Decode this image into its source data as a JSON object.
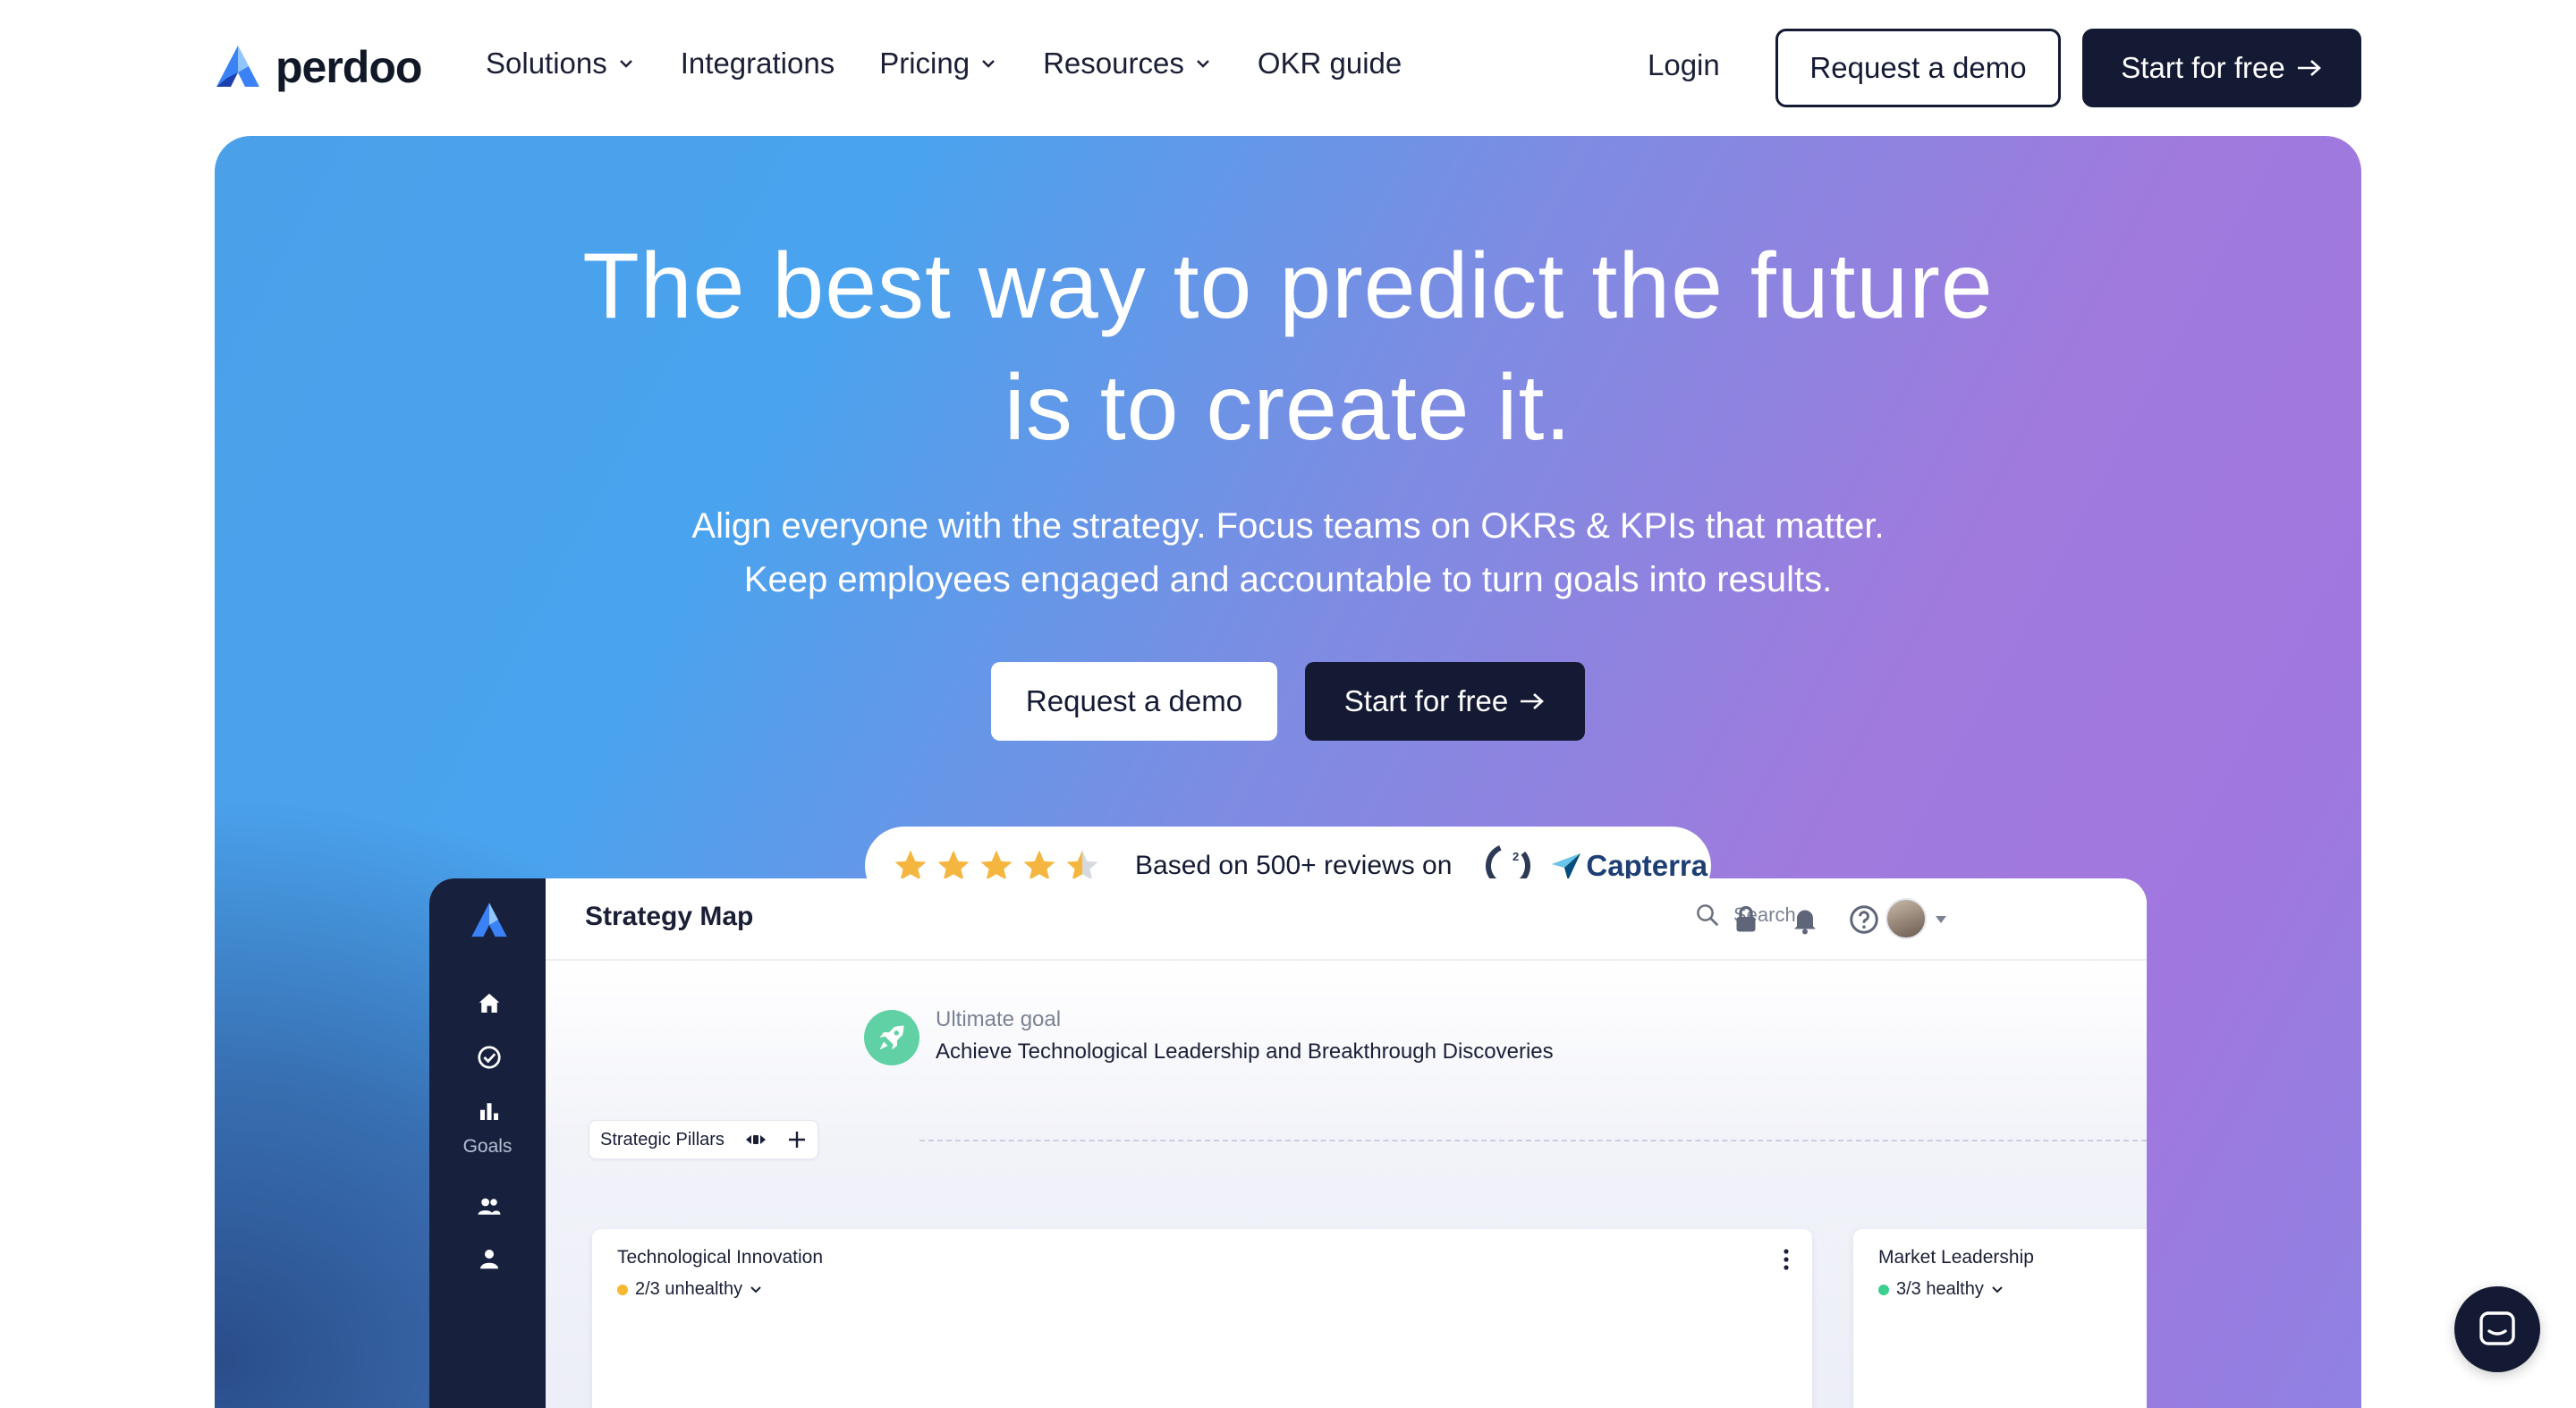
{
  "brand": {
    "name": "perdoo",
    "accent": "#3b82f6",
    "dark": "#141a33"
  },
  "nav": {
    "items": [
      {
        "label": "Solutions",
        "dropdown": true
      },
      {
        "label": "Integrations",
        "dropdown": false
      },
      {
        "label": "Pricing",
        "dropdown": true
      },
      {
        "label": "Resources",
        "dropdown": true
      },
      {
        "label": "OKR guide",
        "dropdown": false
      }
    ],
    "login": "Login",
    "demo": "Request a demo",
    "start": "Start for free"
  },
  "hero": {
    "title_line1": "The best way to predict the future",
    "title_line2": "is to create it.",
    "sub_line1": "Align everyone with the strategy. Focus teams on OKRs & KPIs that matter.",
    "sub_line2": "Keep employees engaged and accountable to turn goals into results.",
    "demo_button": "Request a demo",
    "start_button": "Start for free",
    "reviews": {
      "rating": 4.5,
      "max": 5,
      "text": "Based on 500+ reviews on",
      "capterra": "Capterra",
      "star_color": "#f4b63f"
    }
  },
  "app": {
    "title": "Strategy Map",
    "search_placeholder": "Search...",
    "sidebar": {
      "goals_label": "Goals"
    },
    "ultimate_goal": {
      "label": "Ultimate goal",
      "text": "Achieve Technological Leadership and Breakthrough Discoveries"
    },
    "pillars_label": "Strategic Pillars",
    "cards": [
      {
        "title": "Technological Innovation",
        "status": "2/3 unhealthy",
        "status_color": "#f5b830"
      },
      {
        "title": "Market Leadership",
        "status": "3/3 healthy",
        "status_color": "#3ccf8e"
      }
    ]
  }
}
